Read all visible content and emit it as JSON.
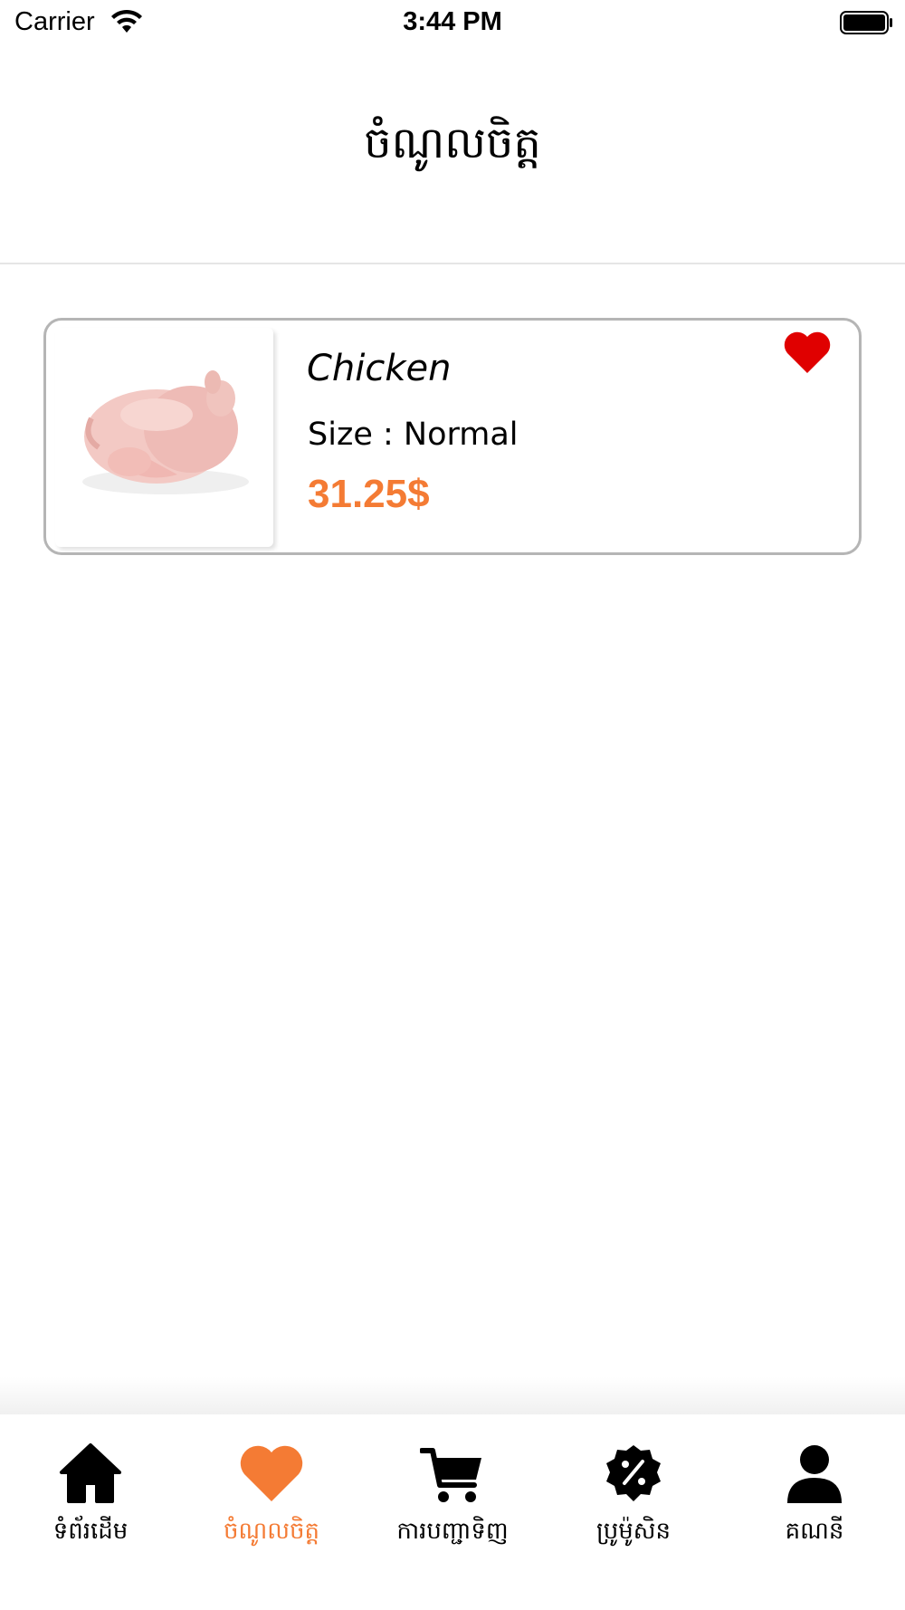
{
  "status_bar": {
    "carrier": "Carrier",
    "time": "3:44 PM"
  },
  "header": {
    "title": "ចំណូលចិត្ត"
  },
  "favorites": [
    {
      "name": "Chicken",
      "size": "Size : Normal",
      "price": "31.25$",
      "favorited": true
    }
  ],
  "tab_bar": {
    "tabs": [
      {
        "label": "ទំព័រដើម",
        "icon": "home-icon",
        "active": false
      },
      {
        "label": "ចំណូលចិត្ត",
        "icon": "heart-icon",
        "active": true
      },
      {
        "label": "ការបញ្ជាទិញ",
        "icon": "cart-icon",
        "active": false
      },
      {
        "label": "ប្រូម៉ូសិន",
        "icon": "discount-badge-icon",
        "active": false
      },
      {
        "label": "គណនី",
        "icon": "user-icon",
        "active": false
      }
    ]
  },
  "colors": {
    "accent": "#f47b34",
    "favorite_heart": "#e00000",
    "card_border": "#b5b5b5"
  }
}
